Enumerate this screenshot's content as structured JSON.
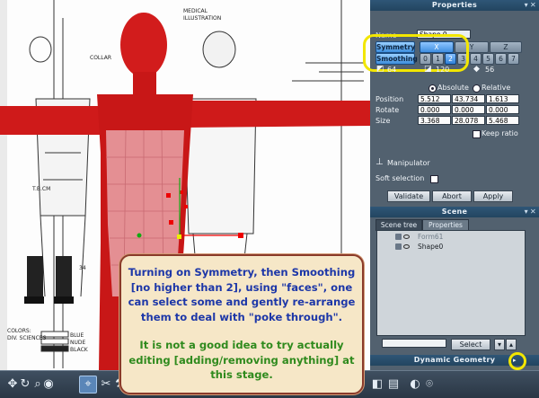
{
  "properties": {
    "title": "Properties",
    "name_label": "Name",
    "name_value": "Shape 0",
    "symmetry_label": "Symmetry",
    "axes": [
      "X",
      "Y",
      "Z"
    ],
    "smoothing_label": "Smoothing",
    "smoothing_levels": [
      "0",
      "1",
      "2",
      "3",
      "4",
      "5",
      "6",
      "7"
    ],
    "counts": [
      "64",
      "120",
      "56"
    ],
    "absolute_label": "Absolute",
    "relative_label": "Relative",
    "position_label": "Position",
    "position": [
      "5.512",
      "43.734",
      "1.613"
    ],
    "rotate_label": "Rotate",
    "rotate": [
      "0.000",
      "0.000",
      "0.000"
    ],
    "size_label": "Size",
    "size": [
      "3.368",
      "28.078",
      "5.468"
    ],
    "keep_ratio_label": "Keep ratio",
    "manipulator_label": "Manipulator",
    "soft_selection_label": "Soft selection",
    "validate_label": "Validate",
    "abort_label": "Abort",
    "apply_label": "Apply"
  },
  "scene": {
    "title": "Scene",
    "tabs": [
      "Scene tree",
      "Properties"
    ],
    "tree": [
      "Form61",
      "Shape0"
    ],
    "select_label": "Select"
  },
  "dynamic_geometry": {
    "title": "Dynamic Geometry"
  },
  "viewport": {
    "reference_labels": [
      "COLLAR",
      "MEDICAL",
      "ILLUSTRATION",
      "T.B.CM",
      "34",
      "COLORS:",
      "DIV. SCIENCES",
      "BLUE",
      "NUDE",
      "BLACK"
    ]
  },
  "callout": {
    "blue_text": "Turning on Symmetry, then Smoothing [no higher than 2], using \"faces\", one can select some and gently re-arrange them to deal with \"poke through\".",
    "green_text": "It is not a good idea to try actually editing [adding/removing anything] at this stage."
  },
  "colors": {
    "mesh_red": "#d81818",
    "panel_bg": "#52616f",
    "highlight": "#f2e600",
    "callout_bg": "#f6e7c7"
  }
}
